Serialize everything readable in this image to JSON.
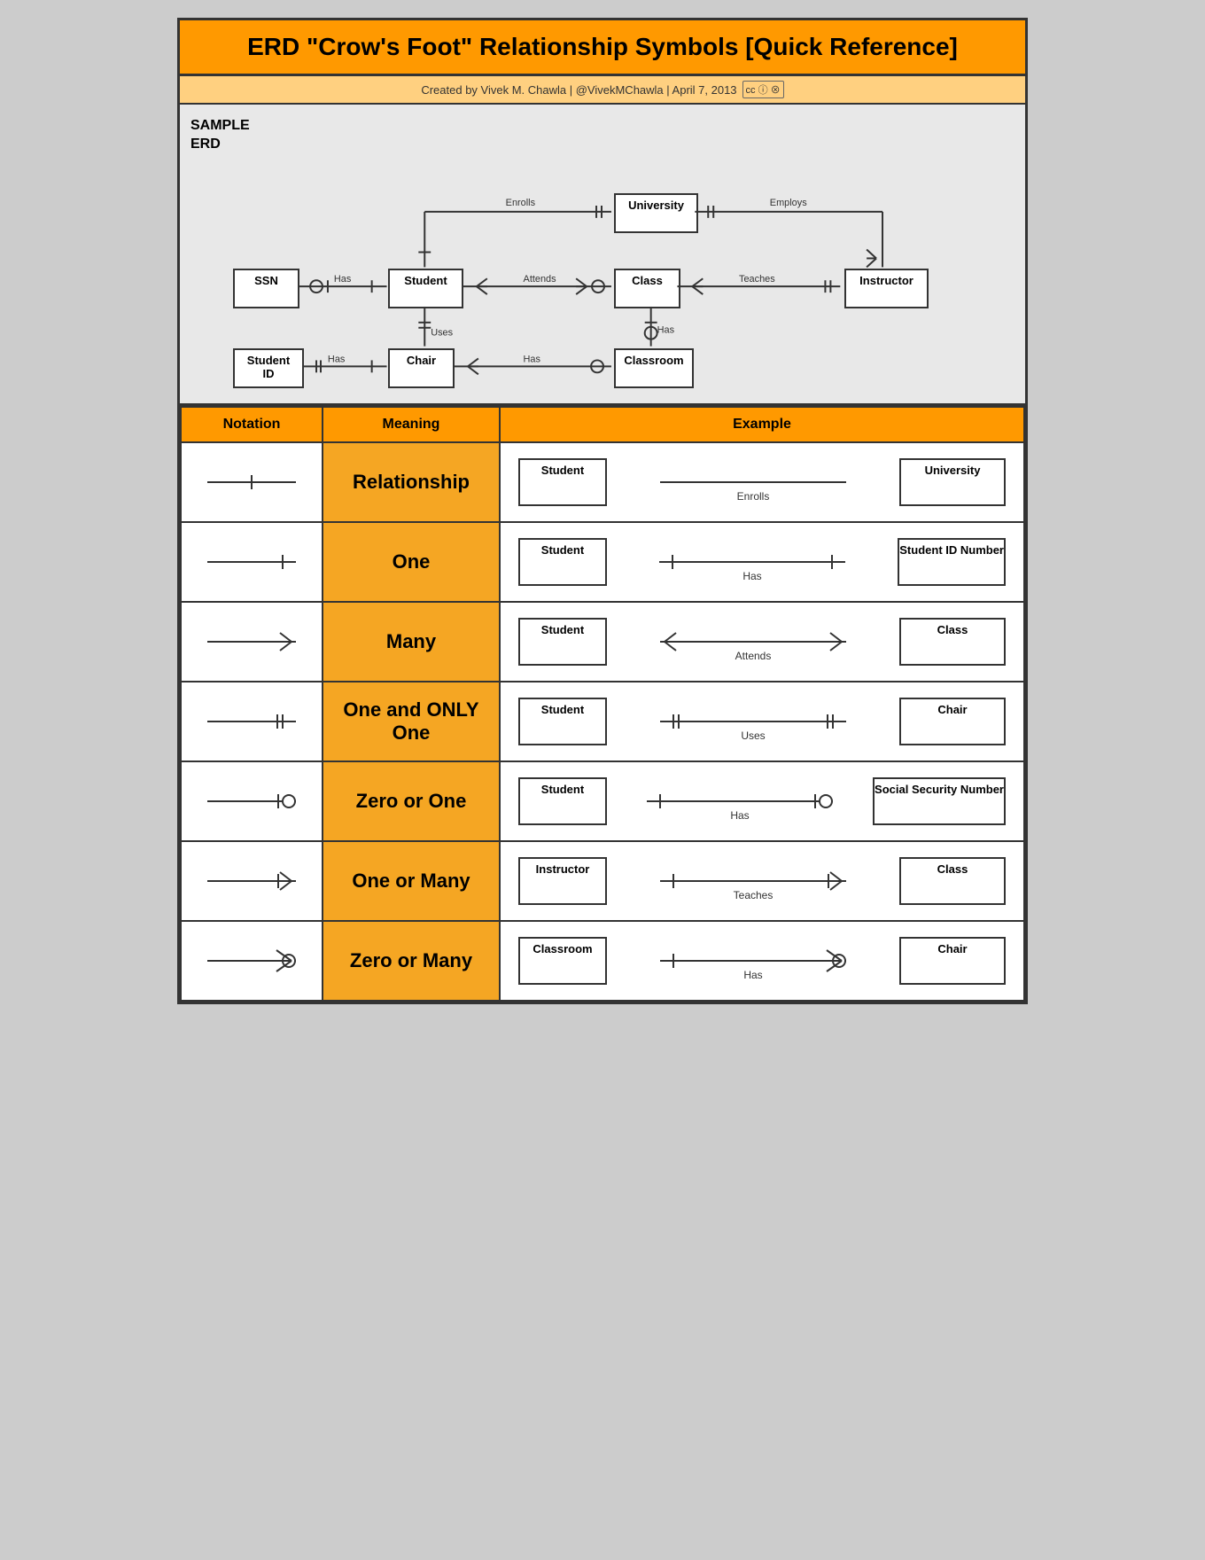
{
  "title": "ERD \"Crow's Foot\" Relationship Symbols [Quick Reference]",
  "subtitle": "Created by Vivek M. Chawla  |  @VivekMChawla  |  April 7, 2013",
  "license": "cc by nc",
  "erd_label": "SAMPLE\nERD",
  "header": {
    "notation": "Notation",
    "meaning": "Meaning",
    "example": "Example"
  },
  "rows": [
    {
      "meaning": "Relationship",
      "left_entity": "Student",
      "right_entity": "University",
      "relation_label": "Enrolls",
      "left_symbol": "none",
      "right_symbol": "none"
    },
    {
      "meaning": "One",
      "left_entity": "Student",
      "right_entity": "Student ID Number",
      "relation_label": "Has",
      "left_symbol": "one_left",
      "right_symbol": "one_right"
    },
    {
      "meaning": "Many",
      "left_entity": "Student",
      "right_entity": "Class",
      "relation_label": "Attends",
      "left_symbol": "many_left",
      "right_symbol": "many_right"
    },
    {
      "meaning": "One and ONLY One",
      "left_entity": "Student",
      "right_entity": "Chair",
      "relation_label": "Uses",
      "left_symbol": "onlyone_left",
      "right_symbol": "onlyone_right"
    },
    {
      "meaning": "Zero or One",
      "left_entity": "Student",
      "right_entity": "Social Security Number",
      "relation_label": "Has",
      "left_symbol": "one_left",
      "right_symbol": "zeroorone_right"
    },
    {
      "meaning": "One or Many",
      "left_entity": "Instructor",
      "right_entity": "Class",
      "relation_label": "Teaches",
      "left_symbol": "one_left",
      "right_symbol": "onemany_right"
    },
    {
      "meaning": "Zero or Many",
      "left_entity": "Classroom",
      "right_entity": "Chair",
      "relation_label": "Has",
      "left_symbol": "one_left",
      "right_symbol": "zeromany_right"
    }
  ]
}
